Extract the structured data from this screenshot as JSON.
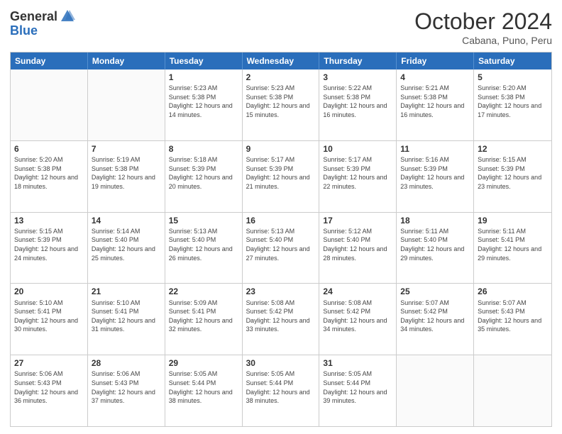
{
  "header": {
    "logo_general": "General",
    "logo_blue": "Blue",
    "month_title": "October 2024",
    "subtitle": "Cabana, Puno, Peru"
  },
  "calendar": {
    "weekdays": [
      "Sunday",
      "Monday",
      "Tuesday",
      "Wednesday",
      "Thursday",
      "Friday",
      "Saturday"
    ],
    "rows": [
      [
        {
          "day": "",
          "info": ""
        },
        {
          "day": "",
          "info": ""
        },
        {
          "day": "1",
          "info": "Sunrise: 5:23 AM\nSunset: 5:38 PM\nDaylight: 12 hours and 14 minutes."
        },
        {
          "day": "2",
          "info": "Sunrise: 5:23 AM\nSunset: 5:38 PM\nDaylight: 12 hours and 15 minutes."
        },
        {
          "day": "3",
          "info": "Sunrise: 5:22 AM\nSunset: 5:38 PM\nDaylight: 12 hours and 16 minutes."
        },
        {
          "day": "4",
          "info": "Sunrise: 5:21 AM\nSunset: 5:38 PM\nDaylight: 12 hours and 16 minutes."
        },
        {
          "day": "5",
          "info": "Sunrise: 5:20 AM\nSunset: 5:38 PM\nDaylight: 12 hours and 17 minutes."
        }
      ],
      [
        {
          "day": "6",
          "info": "Sunrise: 5:20 AM\nSunset: 5:38 PM\nDaylight: 12 hours and 18 minutes."
        },
        {
          "day": "7",
          "info": "Sunrise: 5:19 AM\nSunset: 5:38 PM\nDaylight: 12 hours and 19 minutes."
        },
        {
          "day": "8",
          "info": "Sunrise: 5:18 AM\nSunset: 5:39 PM\nDaylight: 12 hours and 20 minutes."
        },
        {
          "day": "9",
          "info": "Sunrise: 5:17 AM\nSunset: 5:39 PM\nDaylight: 12 hours and 21 minutes."
        },
        {
          "day": "10",
          "info": "Sunrise: 5:17 AM\nSunset: 5:39 PM\nDaylight: 12 hours and 22 minutes."
        },
        {
          "day": "11",
          "info": "Sunrise: 5:16 AM\nSunset: 5:39 PM\nDaylight: 12 hours and 23 minutes."
        },
        {
          "day": "12",
          "info": "Sunrise: 5:15 AM\nSunset: 5:39 PM\nDaylight: 12 hours and 23 minutes."
        }
      ],
      [
        {
          "day": "13",
          "info": "Sunrise: 5:15 AM\nSunset: 5:39 PM\nDaylight: 12 hours and 24 minutes."
        },
        {
          "day": "14",
          "info": "Sunrise: 5:14 AM\nSunset: 5:40 PM\nDaylight: 12 hours and 25 minutes."
        },
        {
          "day": "15",
          "info": "Sunrise: 5:13 AM\nSunset: 5:40 PM\nDaylight: 12 hours and 26 minutes."
        },
        {
          "day": "16",
          "info": "Sunrise: 5:13 AM\nSunset: 5:40 PM\nDaylight: 12 hours and 27 minutes."
        },
        {
          "day": "17",
          "info": "Sunrise: 5:12 AM\nSunset: 5:40 PM\nDaylight: 12 hours and 28 minutes."
        },
        {
          "day": "18",
          "info": "Sunrise: 5:11 AM\nSunset: 5:40 PM\nDaylight: 12 hours and 29 minutes."
        },
        {
          "day": "19",
          "info": "Sunrise: 5:11 AM\nSunset: 5:41 PM\nDaylight: 12 hours and 29 minutes."
        }
      ],
      [
        {
          "day": "20",
          "info": "Sunrise: 5:10 AM\nSunset: 5:41 PM\nDaylight: 12 hours and 30 minutes."
        },
        {
          "day": "21",
          "info": "Sunrise: 5:10 AM\nSunset: 5:41 PM\nDaylight: 12 hours and 31 minutes."
        },
        {
          "day": "22",
          "info": "Sunrise: 5:09 AM\nSunset: 5:41 PM\nDaylight: 12 hours and 32 minutes."
        },
        {
          "day": "23",
          "info": "Sunrise: 5:08 AM\nSunset: 5:42 PM\nDaylight: 12 hours and 33 minutes."
        },
        {
          "day": "24",
          "info": "Sunrise: 5:08 AM\nSunset: 5:42 PM\nDaylight: 12 hours and 34 minutes."
        },
        {
          "day": "25",
          "info": "Sunrise: 5:07 AM\nSunset: 5:42 PM\nDaylight: 12 hours and 34 minutes."
        },
        {
          "day": "26",
          "info": "Sunrise: 5:07 AM\nSunset: 5:43 PM\nDaylight: 12 hours and 35 minutes."
        }
      ],
      [
        {
          "day": "27",
          "info": "Sunrise: 5:06 AM\nSunset: 5:43 PM\nDaylight: 12 hours and 36 minutes."
        },
        {
          "day": "28",
          "info": "Sunrise: 5:06 AM\nSunset: 5:43 PM\nDaylight: 12 hours and 37 minutes."
        },
        {
          "day": "29",
          "info": "Sunrise: 5:05 AM\nSunset: 5:44 PM\nDaylight: 12 hours and 38 minutes."
        },
        {
          "day": "30",
          "info": "Sunrise: 5:05 AM\nSunset: 5:44 PM\nDaylight: 12 hours and 38 minutes."
        },
        {
          "day": "31",
          "info": "Sunrise: 5:05 AM\nSunset: 5:44 PM\nDaylight: 12 hours and 39 minutes."
        },
        {
          "day": "",
          "info": ""
        },
        {
          "day": "",
          "info": ""
        }
      ]
    ]
  }
}
